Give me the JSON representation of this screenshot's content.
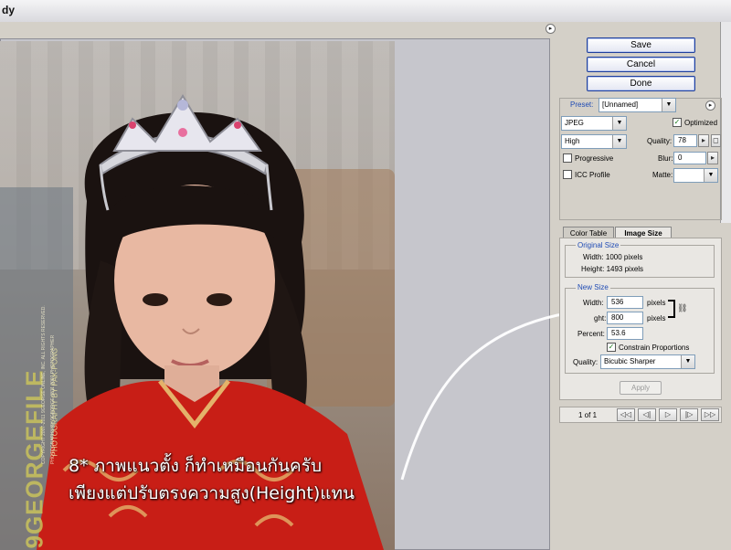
{
  "window": {
    "title": "dy"
  },
  "buttons": {
    "save": "Save",
    "cancel": "Cancel",
    "done": "Done"
  },
  "settings": {
    "preset_label": "Preset:",
    "preset_value": "[Unnamed]",
    "format_value": "JPEG",
    "optimized_label": "Optimized",
    "optimized_checked": true,
    "quality_level": "High",
    "quality_label": "Quality:",
    "quality_value": "78",
    "progressive_label": "Progressive",
    "blur_label": "Blur:",
    "blur_value": "0",
    "icc_label": "ICC Profile",
    "matte_label": "Matte:"
  },
  "tabs": [
    {
      "label": "Color Table"
    },
    {
      "label": "Image Size"
    }
  ],
  "image_size": {
    "original_title": "Original Size",
    "original_width": "Width: 1000 pixels",
    "original_height": "Height: 1493 pixels",
    "new_title": "New Size",
    "width_label": "Width:",
    "width_value": "536",
    "height_label_visible": "ght:",
    "height_value": "800",
    "unit": "pixels",
    "percent_label": "Percent:",
    "percent_value": "53.6",
    "constrain_label": "Constrain Proportions",
    "constrain_checked": true,
    "quality_label": "Quality:",
    "quality_value": "Bicubic Sharper",
    "apply_label": "Apply"
  },
  "animation": {
    "frame_counter": "1 of 1"
  },
  "icons": {
    "panel_menu": "arrow-right-circle-icon",
    "link": "chain-link-icon",
    "first": "first-frame-icon",
    "prev": "previous-frame-icon",
    "play": "play-icon",
    "next": "next-frame-icon",
    "last": "last-frame-icon"
  },
  "watermark": {
    "brand": "9GEORGEFILE",
    "credit": "PHOTOGRAPHY BY PAK-PONG",
    "small_line_1": "COPYRIGHT 2007-2011 9GEORGE ONLINE, INC. ALL RIGHTS RESERVED.",
    "small_line_2": "PHOTOGRAPHY BY 9GEORGE 0811 2007 PHOTOGRAPHER"
  },
  "annotation": {
    "line1": "8* ภาพแนวตั้ง ก็ทำเหมือนกันครับ",
    "line2": "เพียงแต่ปรับตรงความสูง(Height)แทน"
  },
  "colors": {
    "button_border": "#1f3f9c",
    "group_title": "#1f4bb4",
    "panel_bg": "#d4d0c8"
  }
}
